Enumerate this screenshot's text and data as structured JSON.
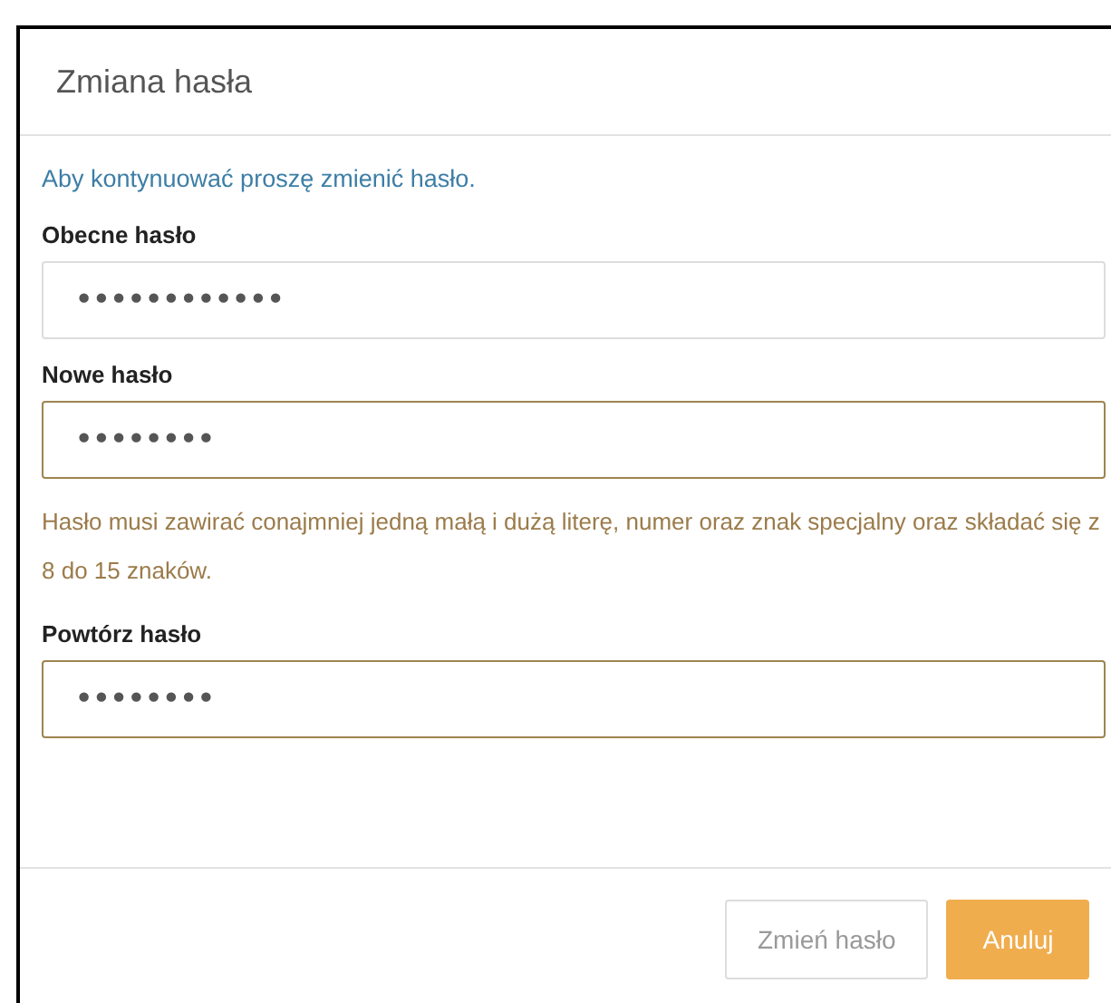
{
  "dialog": {
    "title": "Zmiana hasła",
    "info": "Aby kontynuować proszę zmienić hasło.",
    "fields": [
      {
        "label": "Obecne hasło",
        "value": "••••••••••••",
        "warning": false
      },
      {
        "label": "Nowe hasło",
        "value": "••••••••",
        "warning": true,
        "hint": "Hasło musi zawirać conajmniej jedną małą i dużą literę, numer oraz znak specjalny oraz składać się z 8 do 15 znaków."
      },
      {
        "label": "Powtórz hasło",
        "value": "••••••••",
        "warning": true
      }
    ],
    "buttons": [
      {
        "label": "Zmień hasło",
        "kind": "secondary",
        "disabled": true
      },
      {
        "label": "Anuluj",
        "kind": "primary",
        "disabled": false
      }
    ]
  }
}
